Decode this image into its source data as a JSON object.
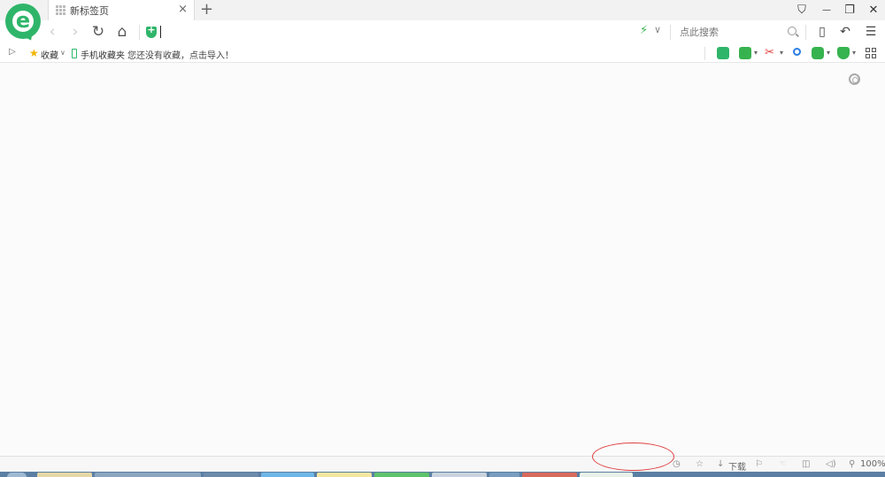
{
  "tab": {
    "title": "新标签页",
    "close_glyph": "×",
    "new_tab_glyph": "+"
  },
  "window": {
    "skin_glyph": "⛉",
    "minimize_glyph": "—",
    "restore_glyph": "❐",
    "close_glyph": "✕"
  },
  "nav": {
    "back_glyph": "‹",
    "forward_glyph": "›",
    "reload_glyph": "↻",
    "home_glyph": "⌂",
    "address_value": "",
    "bolt_glyph": "⚡",
    "dropdown_glyph": "∨",
    "search_placeholder": "点此搜索",
    "device_glyph": "▯",
    "undo_glyph": "↶",
    "menu_glyph": "☰"
  },
  "bookmarks": {
    "sidebar_toggle_glyph": "▷",
    "favorites_label": "收藏",
    "favorites_caret": "∨",
    "mobile_favorites_label": "手机收藏夹",
    "empty_hint": "您还没有收藏，点击导入！"
  },
  "status": {
    "download_label": "下载",
    "zoom_label": "100%"
  },
  "colors": {
    "brand_green": "#2fb56a",
    "annotation_red": "#e04040",
    "taskbar_blue": "#5b7fa3"
  }
}
